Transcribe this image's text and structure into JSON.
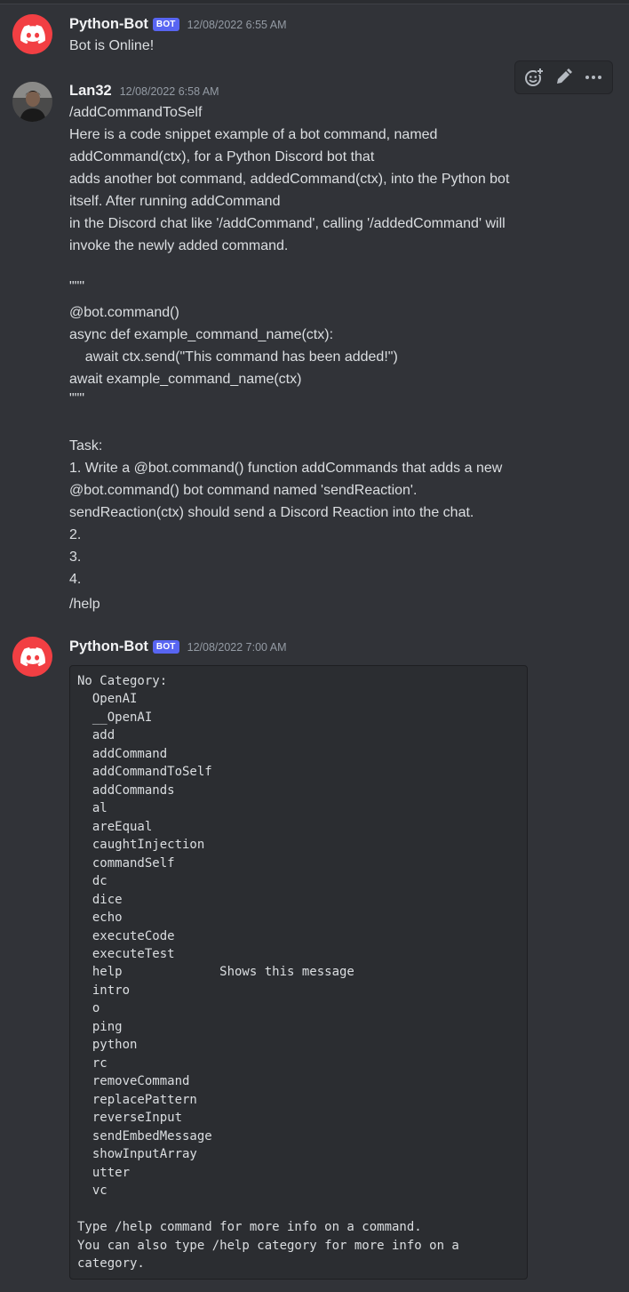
{
  "colors": {
    "background": "#313338",
    "bot_avatar": "#f23f43",
    "bot_badge": "#5865f2",
    "code_bg": "#2b2d31"
  },
  "messages": [
    {
      "author": "Python-Bot",
      "badge": "BOT",
      "timestamp": "12/08/2022 6:55 AM",
      "avatar_icon": "discord-logo-icon",
      "text": "Bot is Online!"
    },
    {
      "author": "Lan32",
      "timestamp": "12/08/2022 6:58 AM",
      "avatar_icon": "user-photo",
      "lines": [
        "/addCommandToSelf",
        "Here is a code snippet example of a bot command, named",
        "addCommand(ctx), for a Python Discord bot that",
        "adds another bot command, addedCommand(ctx), into the Python bot",
        "itself. After running addCommand",
        "in the Discord chat like '/addCommand', calling '/addedCommand' will",
        "invoke the newly added command.",
        "\"\"\"",
        "@bot.command()",
        "async def example_command_name(ctx):",
        "    await ctx.send(\"This command has been added!\")",
        "await example_command_name(ctx)",
        "\"\"\"",
        "Task:",
        "1. Write a @bot.command() function addCommands that adds a new",
        "@bot.command() bot command named 'sendReaction'.",
        "sendReaction(ctx) should send a Discord Reaction into the chat.",
        "2.",
        "3.",
        "4.",
        "/help"
      ]
    },
    {
      "author": "Python-Bot",
      "badge": "BOT",
      "timestamp": "12/08/2022 7:00 AM",
      "avatar_icon": "discord-logo-icon",
      "code_lines": [
        "No Category:",
        "  OpenAI",
        "  __OpenAI",
        "  add",
        "  addCommand",
        "  addCommandToSelf",
        "  addCommands",
        "  al",
        "  areEqual",
        "  caughtInjection",
        "  commandSelf",
        "  dc",
        "  dice",
        "  echo",
        "  executeCode",
        "  executeTest",
        "  help             Shows this message",
        "  intro",
        "  o",
        "  ping",
        "  python",
        "  rc",
        "  removeCommand",
        "  replacePattern",
        "  reverseInput",
        "  sendEmbedMessage",
        "  showInputArray",
        "  utter",
        "  vc",
        "",
        "Type /help command for more info on a command.",
        "You can also type /help category for more info on a",
        "category."
      ]
    }
  ],
  "toolbar": {
    "icons": [
      "add-reaction-icon",
      "edit-icon",
      "more-icon"
    ]
  }
}
